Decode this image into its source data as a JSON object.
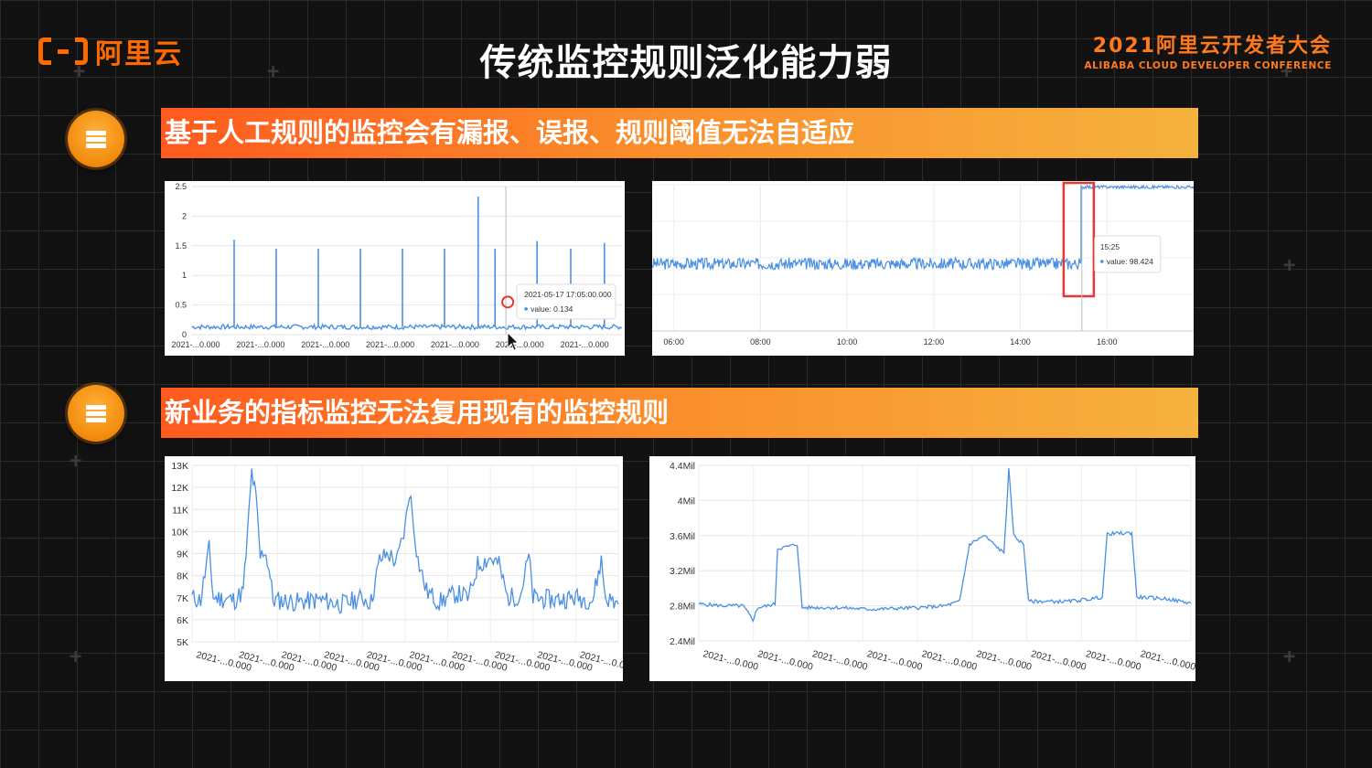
{
  "header": {
    "logo_text": "阿里云",
    "title": "传统监控规则泛化能力弱",
    "conference_title": "2021阿里云开发者大会",
    "conference_subtitle": "ALIBABA CLOUD DEVELOPER CONFERENCE"
  },
  "sections": [
    {
      "label": "基于人工规则的监控会有漏报、误报、规则阈值无法自适应",
      "icon": "server-stack-icon"
    },
    {
      "label": "新业务的指标监控无法复用现有的监控规则",
      "icon": "server-stack-icon"
    }
  ],
  "colors": {
    "accent": "#ff6a00",
    "series": "#4a90e2",
    "highlight": "#e53935"
  },
  "chart_data": [
    {
      "type": "line",
      "ylim": [
        0,
        2.5
      ],
      "y_ticks": [
        "0",
        "0.5",
        "1",
        "1.5",
        "2",
        "2.5"
      ],
      "x_ticks": [
        "2021-...0.000",
        "2021-...0.000",
        "2021-...0.000",
        "2021-...0.000",
        "2021-...0.000",
        "2021-...0.000",
        "2021-...0.000"
      ],
      "baseline": 0.13,
      "spikes": [
        {
          "x": 0.1,
          "y": 1.6
        },
        {
          "x": 0.2,
          "y": 1.45
        },
        {
          "x": 0.3,
          "y": 1.45
        },
        {
          "x": 0.4,
          "y": 1.45
        },
        {
          "x": 0.5,
          "y": 1.45
        },
        {
          "x": 0.6,
          "y": 1.45
        },
        {
          "x": 0.68,
          "y": 2.33
        },
        {
          "x": 0.72,
          "y": 1.45
        },
        {
          "x": 0.82,
          "y": 1.58
        },
        {
          "x": 0.9,
          "y": 1.45
        },
        {
          "x": 0.98,
          "y": 1.55
        }
      ],
      "tooltip": {
        "time": "2021-05-17 17:05:00.000",
        "value_label": "value: 0.134"
      },
      "tooltip_x": 0.73
    },
    {
      "type": "line",
      "ylim": [
        0,
        100
      ],
      "x_ticks": [
        "06:00",
        "08:00",
        "10:00",
        "12:00",
        "14:00",
        "16:00"
      ],
      "x_range": [
        5.5,
        18.0
      ],
      "baseline": 46,
      "jump_at": 15.4,
      "jump_level": 98.4,
      "tooltip": {
        "time": "15:25",
        "value_label": "value: 98.424"
      },
      "tooltip_x": 15.42
    },
    {
      "type": "line",
      "ylim": [
        5000,
        13000
      ],
      "y_ticks": [
        "5K",
        "6K",
        "7K",
        "8K",
        "9K",
        "10K",
        "11K",
        "12K",
        "13K"
      ],
      "x_ticks": [
        "2021-...0.000",
        "2021-...0.000",
        "2021-...0.000",
        "2021-...0.000",
        "2021-...0.000",
        "2021-...0.000",
        "2021-...0.000",
        "2021-...0.000",
        "2021-...0.000",
        "2021-...0.000"
      ],
      "points": [
        [
          0,
          7000
        ],
        [
          0.02,
          6900
        ],
        [
          0.04,
          9200
        ],
        [
          0.05,
          7000
        ],
        [
          0.1,
          6900
        ],
        [
          0.12,
          7300
        ],
        [
          0.13,
          9800
        ],
        [
          0.14,
          12700
        ],
        [
          0.15,
          11500
        ],
        [
          0.16,
          8800
        ],
        [
          0.17,
          9200
        ],
        [
          0.18,
          8400
        ],
        [
          0.19,
          6900
        ],
        [
          0.25,
          6800
        ],
        [
          0.3,
          6900
        ],
        [
          0.35,
          6700
        ],
        [
          0.4,
          7000
        ],
        [
          0.42,
          6800
        ],
        [
          0.44,
          8700
        ],
        [
          0.46,
          9000
        ],
        [
          0.48,
          8600
        ],
        [
          0.5,
          10200
        ],
        [
          0.51,
          11900
        ],
        [
          0.52,
          10300
        ],
        [
          0.53,
          8700
        ],
        [
          0.55,
          7300
        ],
        [
          0.58,
          6800
        ],
        [
          0.62,
          7200
        ],
        [
          0.65,
          7000
        ],
        [
          0.67,
          8500
        ],
        [
          0.7,
          8800
        ],
        [
          0.72,
          8500
        ],
        [
          0.74,
          7000
        ],
        [
          0.77,
          7100
        ],
        [
          0.79,
          8900
        ],
        [
          0.8,
          7000
        ],
        [
          0.85,
          6900
        ],
        [
          0.9,
          7000
        ],
        [
          0.94,
          6900
        ],
        [
          0.96,
          8700
        ],
        [
          0.97,
          7000
        ],
        [
          1.0,
          6700
        ]
      ]
    },
    {
      "type": "line",
      "ylim": [
        2400000,
        4400000
      ],
      "y_ticks": [
        "2.4Mil",
        "2.8Mil",
        "3.2Mil",
        "3.6Mil",
        "4Mil",
        "4.4Mil"
      ],
      "x_ticks": [
        "2021-...0.000",
        "2021-...0.000",
        "2021-...0.000",
        "2021-...0.000",
        "2021-...0.000",
        "2021-...0.000",
        "2021-...0.000",
        "2021-...0.000",
        "2021-...0.000"
      ],
      "points": [
        [
          0,
          2820000
        ],
        [
          0.05,
          2800000
        ],
        [
          0.09,
          2800000
        ],
        [
          0.1,
          2720000
        ],
        [
          0.11,
          2640000
        ],
        [
          0.12,
          2780000
        ],
        [
          0.14,
          2800000
        ],
        [
          0.155,
          2820000
        ],
        [
          0.16,
          3450000
        ],
        [
          0.2,
          3500000
        ],
        [
          0.21,
          2780000
        ],
        [
          0.28,
          2780000
        ],
        [
          0.35,
          2760000
        ],
        [
          0.45,
          2780000
        ],
        [
          0.5,
          2800000
        ],
        [
          0.53,
          2850000
        ],
        [
          0.55,
          3500000
        ],
        [
          0.58,
          3600000
        ],
        [
          0.6,
          3500000
        ],
        [
          0.62,
          3400000
        ],
        [
          0.63,
          4350000
        ],
        [
          0.64,
          3600000
        ],
        [
          0.66,
          3500000
        ],
        [
          0.67,
          2850000
        ],
        [
          0.75,
          2850000
        ],
        [
          0.8,
          2880000
        ],
        [
          0.82,
          2900000
        ],
        [
          0.83,
          3620000
        ],
        [
          0.88,
          3630000
        ],
        [
          0.89,
          2900000
        ],
        [
          0.95,
          2880000
        ],
        [
          1.0,
          2830000
        ]
      ]
    }
  ]
}
